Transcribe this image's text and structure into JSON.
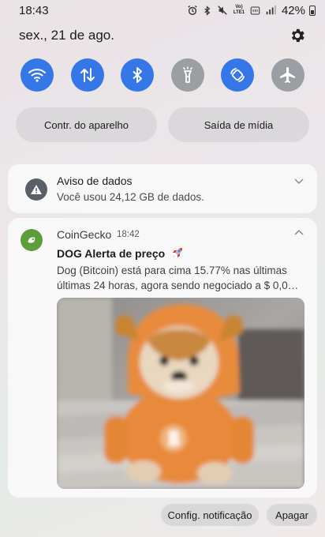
{
  "status_bar": {
    "time": "18:43",
    "network_label": "LTE1",
    "battery_text": "42%"
  },
  "header": {
    "date": "sex., 21 de ago."
  },
  "quick_toggles": [
    {
      "icon": "wifi-icon",
      "state": "on"
    },
    {
      "icon": "mobile-data-icon",
      "state": "on"
    },
    {
      "icon": "bluetooth-icon",
      "state": "on"
    },
    {
      "icon": "flashlight-icon",
      "state": "off"
    },
    {
      "icon": "auto-rotate-icon",
      "state": "on"
    },
    {
      "icon": "airplane-icon",
      "state": "off"
    }
  ],
  "pills": {
    "device_control": "Contr. do aparelho",
    "media_output": "Saída de mídia"
  },
  "data_notification": {
    "title": "Aviso de dados",
    "text": "Você usou 24,12 GB de dados."
  },
  "coingecko_notification": {
    "app": "CoinGecko",
    "time": "18:42",
    "title": "DOG Alerta de preço",
    "line1": "Dog (Bitcoin) está para cima 15.77% nas últimas",
    "line2": "últimas 24 horas, agora sendo negociado a $ 0,0…"
  },
  "footer": {
    "config_label": "Config. notificação",
    "clear_label": "Apagar"
  },
  "colors": {
    "toggle_on": "#3677e8",
    "toggle_off": "#9b9ea3",
    "coingecko_green": "#5d9e3b"
  }
}
